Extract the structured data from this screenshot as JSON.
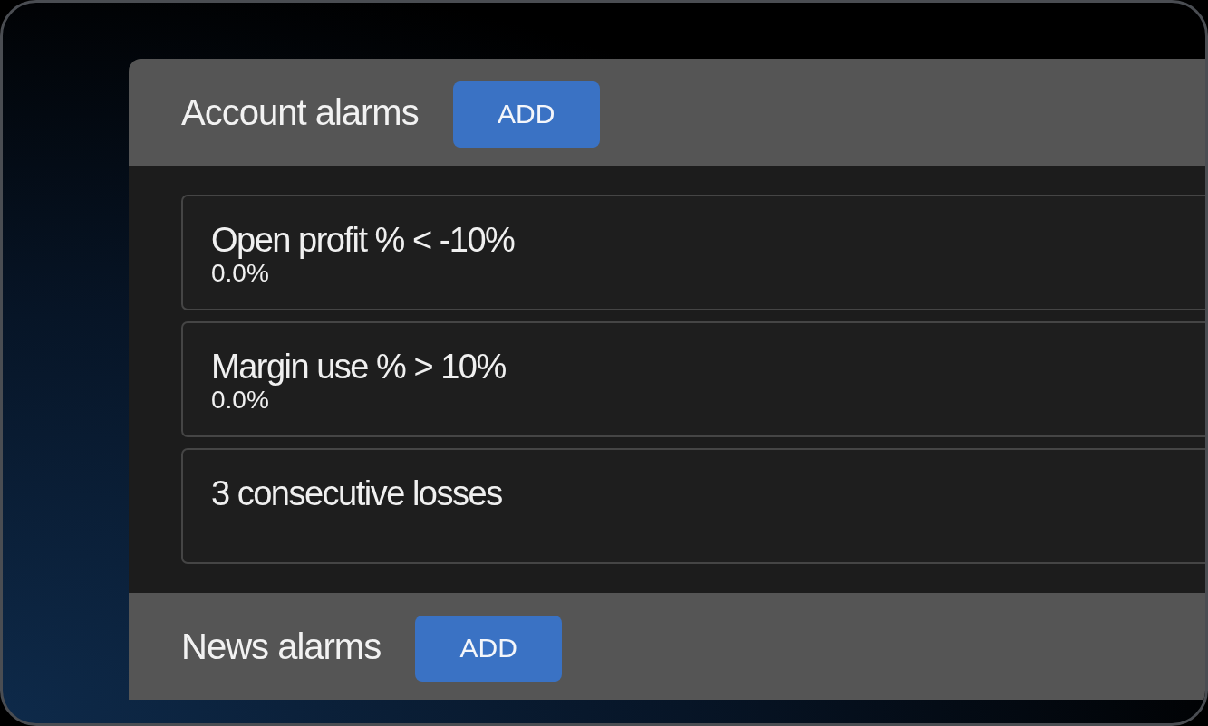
{
  "sections": [
    {
      "title": "Account alarms",
      "button": "ADD",
      "alarms": [
        {
          "name": "Open profit % < -10%",
          "value": "0.0%"
        },
        {
          "name": "Margin use % > 10%",
          "value": "0.0%"
        },
        {
          "name": "3 consecutive losses"
        }
      ]
    },
    {
      "title": "News alarms",
      "button": "ADD"
    }
  ]
}
